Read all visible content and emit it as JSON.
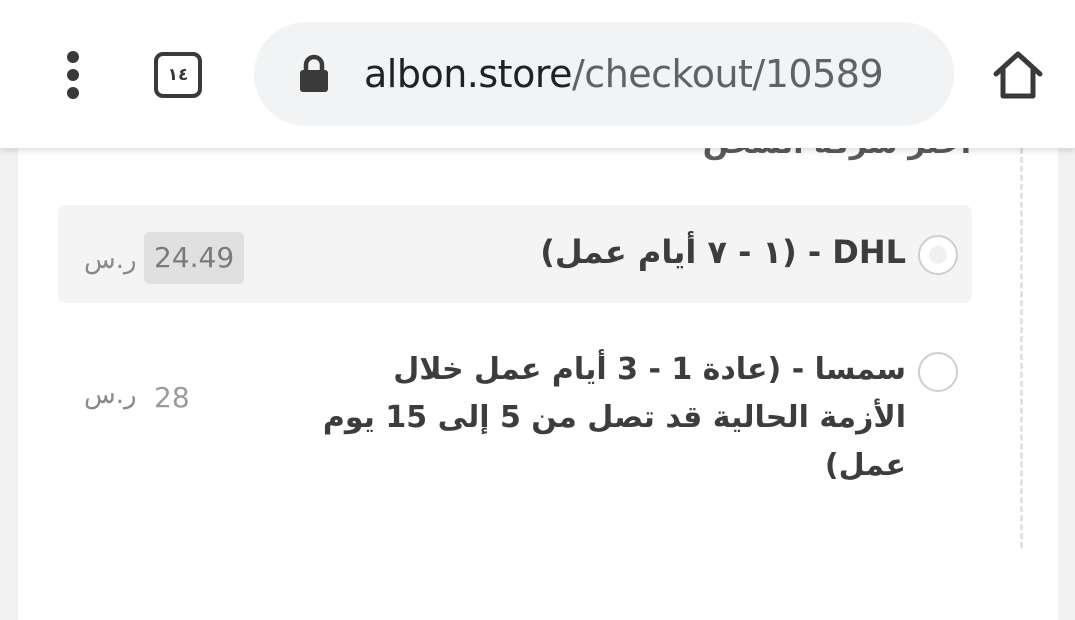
{
  "browser": {
    "tab_count": "١٤",
    "url_host": "albon.store",
    "url_path": "/checkout/10589",
    "icons": {
      "menu": "more-vert-icon",
      "tabs": "tab-switcher-icon",
      "lock": "lock-icon",
      "home": "home-icon"
    }
  },
  "shipping": {
    "section_title": "اختر شركة الشحن",
    "options": [
      {
        "label": "DHL - (١ - ٧ أيام عمل)",
        "price": "24.49",
        "currency": "ر.س",
        "selected": true
      },
      {
        "label": "سمسا - (عادة 1 - 3 أيام عمل خلال الأزمة الحالية قد تصل من 5 إلى 15 يوم عمل)",
        "price": "28",
        "currency": "ر.س",
        "selected": false
      }
    ]
  },
  "colors": {
    "chrome_bg": "#ffffff",
    "omnibox_bg": "#f1f3f4",
    "selected_row_bg": "#f4f4f4",
    "price_badge_bg": "#e0e0e0",
    "label_text": "#3d3d3d"
  }
}
